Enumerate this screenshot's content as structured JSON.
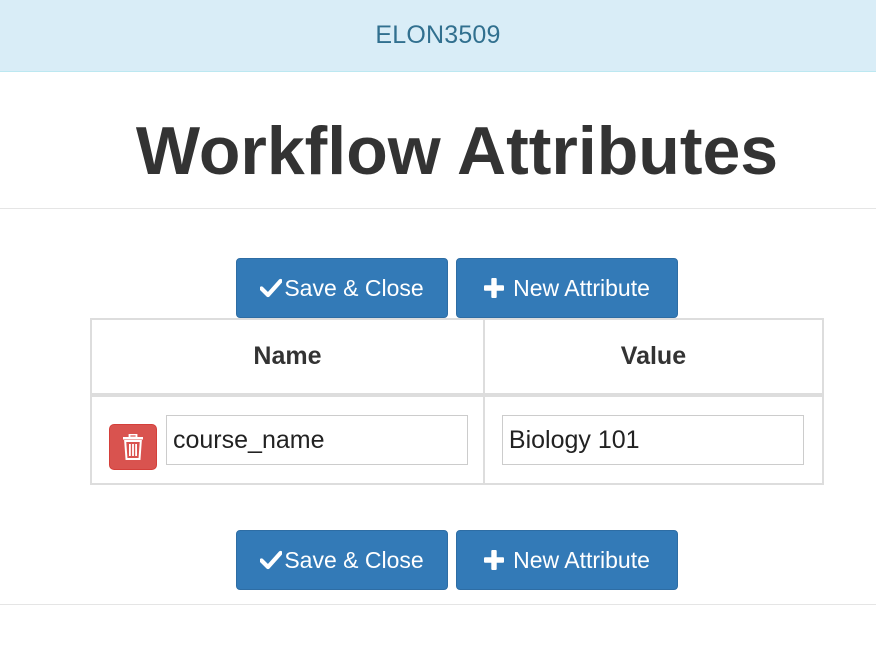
{
  "header": {
    "banner_text": "ELON3509",
    "page_title": "Workflow Attributes"
  },
  "toolbar_top": {
    "save_label": "Save & Close",
    "new_label": "New Attribute"
  },
  "toolbar_bottom": {
    "save_label": "Save & Close",
    "new_label": "New Attribute"
  },
  "table": {
    "columns": [
      "Name",
      "Value"
    ],
    "rows": [
      {
        "name": "course_name",
        "value": "Biology 101"
      }
    ]
  },
  "icons": {
    "save": "check-icon",
    "new": "plus-icon",
    "delete": "trash-icon"
  },
  "colors": {
    "primary": "#337ab7",
    "danger": "#d9534f",
    "banner_bg": "#d9edf7",
    "banner_text": "#31708f"
  }
}
